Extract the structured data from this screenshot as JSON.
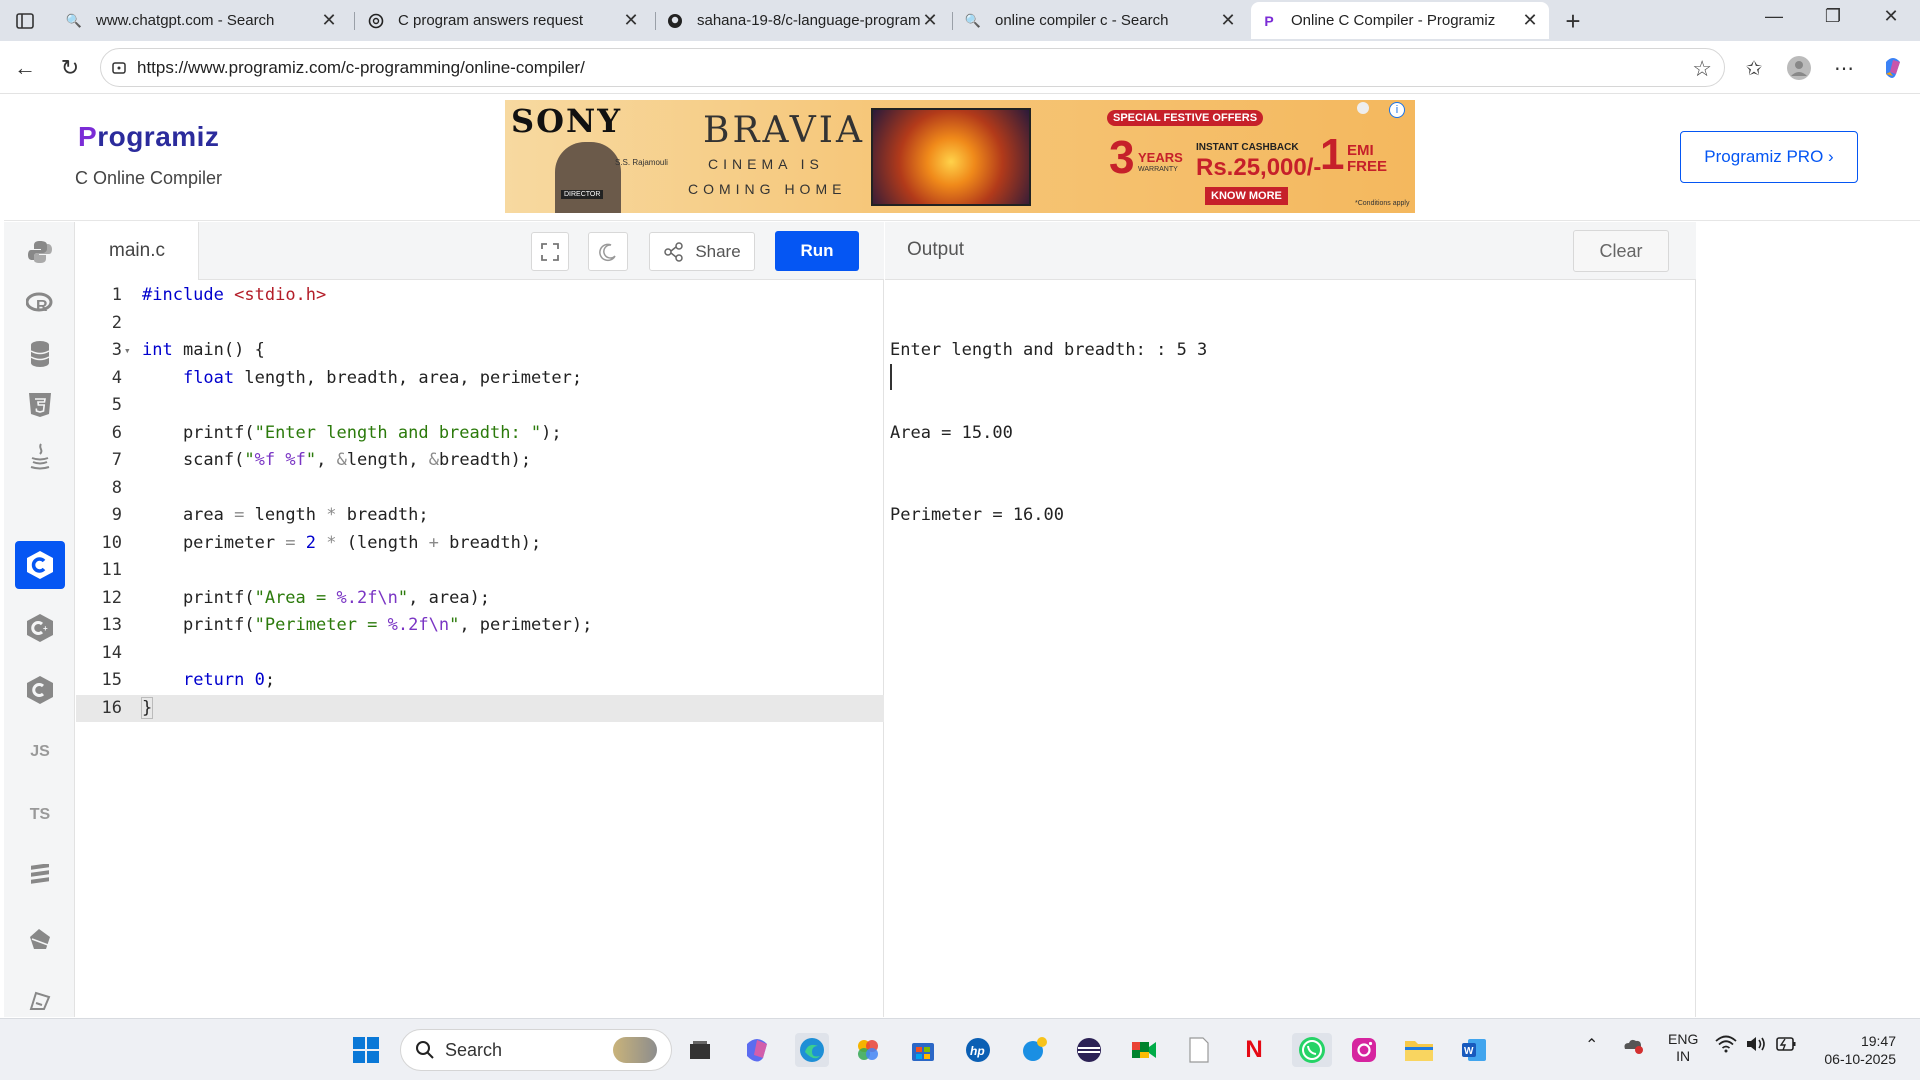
{
  "browser": {
    "tabs": [
      {
        "title": "www.chatgpt.com - Search",
        "icon": "search-icon"
      },
      {
        "title": "C program answers request",
        "icon": "chatgpt-icon"
      },
      {
        "title": "sahana-19-8/c-language-program",
        "icon": "github-icon"
      },
      {
        "title": "online compiler c - Search",
        "icon": "search-icon"
      },
      {
        "title": "Online C Compiler - Programiz",
        "icon": "programiz-icon",
        "active": true
      }
    ],
    "url": "https://www.programiz.com/c-programming/online-compiler/"
  },
  "site": {
    "logo_first": "P",
    "logo_rest": "rogramiz",
    "subtitle": "C Online Compiler",
    "pro_button": "Programiz PRO ›",
    "ad": {
      "brand": "SONY",
      "product": "BRAVIA",
      "tagline1": "CINEMA IS",
      "tagline2": "COMING HOME",
      "person": "S.S. Rajamouli",
      "director": "DIRECTOR",
      "offer": "SPECIAL FESTIVE OFFERS",
      "years_num": "3",
      "years": "YEARS",
      "warranty": "WARRANTY",
      "cashback": "INSTANT CASHBACK",
      "amount": "Rs.25,000/-",
      "emi_num": "1",
      "emi": "EMI",
      "free": "FREE",
      "cta": "KNOW MORE",
      "conditions": "*Conditions apply"
    }
  },
  "sidebar": {
    "items": [
      {
        "name": "python-icon"
      },
      {
        "name": "r-icon"
      },
      {
        "name": "sql-icon"
      },
      {
        "name": "html5-icon"
      },
      {
        "name": "java-icon"
      },
      {
        "name": "c-icon",
        "active": true
      },
      {
        "name": "cpp-icon"
      },
      {
        "name": "csharp-icon"
      },
      {
        "name": "js-icon",
        "label": "JS"
      },
      {
        "name": "ts-icon",
        "label": "TS"
      },
      {
        "name": "swift-icon"
      },
      {
        "name": "go-icon"
      },
      {
        "name": "php-icon"
      }
    ]
  },
  "editor": {
    "filename": "main.c",
    "share_label": "Share",
    "run_label": "Run",
    "lines": [
      "#include <stdio.h>",
      "",
      "int main() {",
      "    float length, breadth, area, perimeter;",
      "",
      "    printf(\"Enter length and breadth: \");",
      "    scanf(\"%f %f\", &length, &breadth);",
      "",
      "    area = length * breadth;",
      "    perimeter = 2 * (length + breadth);",
      "",
      "    printf(\"Area = %.2f\\n\", area);",
      "    printf(\"Perimeter = %.2f\\n\", perimeter);",
      "",
      "    return 0;",
      "}"
    ],
    "highlighted_line": 16
  },
  "output": {
    "title": "Output",
    "clear_label": "Clear",
    "lines": [
      "Enter length and breadth: : 5 3",
      "Area = 15.00",
      "Perimeter = 16.00"
    ]
  },
  "taskbar": {
    "search_label": "Search",
    "lang1": "ENG",
    "lang2": "IN",
    "time": "19:47",
    "date": "06-10-2025"
  }
}
